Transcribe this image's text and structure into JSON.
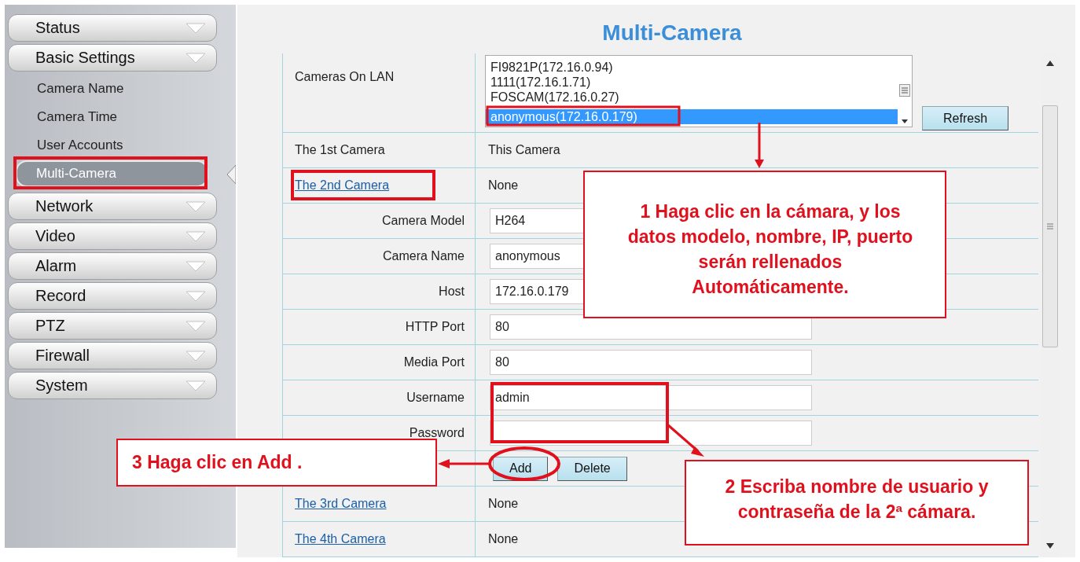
{
  "sidebar": {
    "items": [
      {
        "label": "Status"
      },
      {
        "label": "Basic Settings",
        "children": [
          {
            "label": "Camera Name",
            "selected": false
          },
          {
            "label": "Camera Time",
            "selected": false
          },
          {
            "label": "User Accounts",
            "selected": false
          },
          {
            "label": "Multi-Camera",
            "selected": true
          }
        ]
      },
      {
        "label": "Network"
      },
      {
        "label": "Video"
      },
      {
        "label": "Alarm"
      },
      {
        "label": "Record"
      },
      {
        "label": "PTZ"
      },
      {
        "label": "Firewall"
      },
      {
        "label": "System"
      }
    ]
  },
  "page_title": "Multi-Camera",
  "lan": {
    "label": "Cameras On LAN",
    "items": [
      {
        "text": "FI9821P(172.16.0.94)",
        "selected": false
      },
      {
        "text": "1111(172.16.1.71)",
        "selected": false
      },
      {
        "text": "FOSCAM(172.16.0.27)",
        "selected": false
      },
      {
        "text": "anonymous(172.16.0.179)",
        "selected": true
      }
    ],
    "refresh": "Refresh"
  },
  "rows": [
    {
      "kind": "camera",
      "label": "The 1st Camera",
      "link": false,
      "value": "This Camera"
    },
    {
      "kind": "camera",
      "label": "The 2nd Camera",
      "link": true,
      "value": "None"
    },
    {
      "kind": "field",
      "label": "Camera Model",
      "value": "H264"
    },
    {
      "kind": "field",
      "label": "Camera Name",
      "value": "anonymous"
    },
    {
      "kind": "field",
      "label": "Host",
      "value": "172.16.0.179"
    },
    {
      "kind": "field",
      "label": "HTTP Port",
      "value": "80"
    },
    {
      "kind": "field",
      "label": "Media Port",
      "value": "80"
    },
    {
      "kind": "field",
      "label": "Username",
      "value": "admin"
    },
    {
      "kind": "field",
      "label": "Password"
    },
    {
      "kind": "actions",
      "buttons": [
        "Add",
        "Delete"
      ]
    },
    {
      "kind": "camera",
      "label": "The 3rd Camera",
      "link": true,
      "value": "None"
    },
    {
      "kind": "camera",
      "label": "The 4th Camera",
      "link": true,
      "value": "None"
    }
  ],
  "callouts": [
    {
      "text": "1 Haga clic en la cámara, y los\ndatos modelo, nombre, IP, puerto\nserán rellenados\nAutomáticamente."
    },
    {
      "text": "3 Haga clic en Add ."
    },
    {
      "text": "2 Escriba nombre de usuario y\ncontraseña de la 2ª cámara."
    }
  ]
}
